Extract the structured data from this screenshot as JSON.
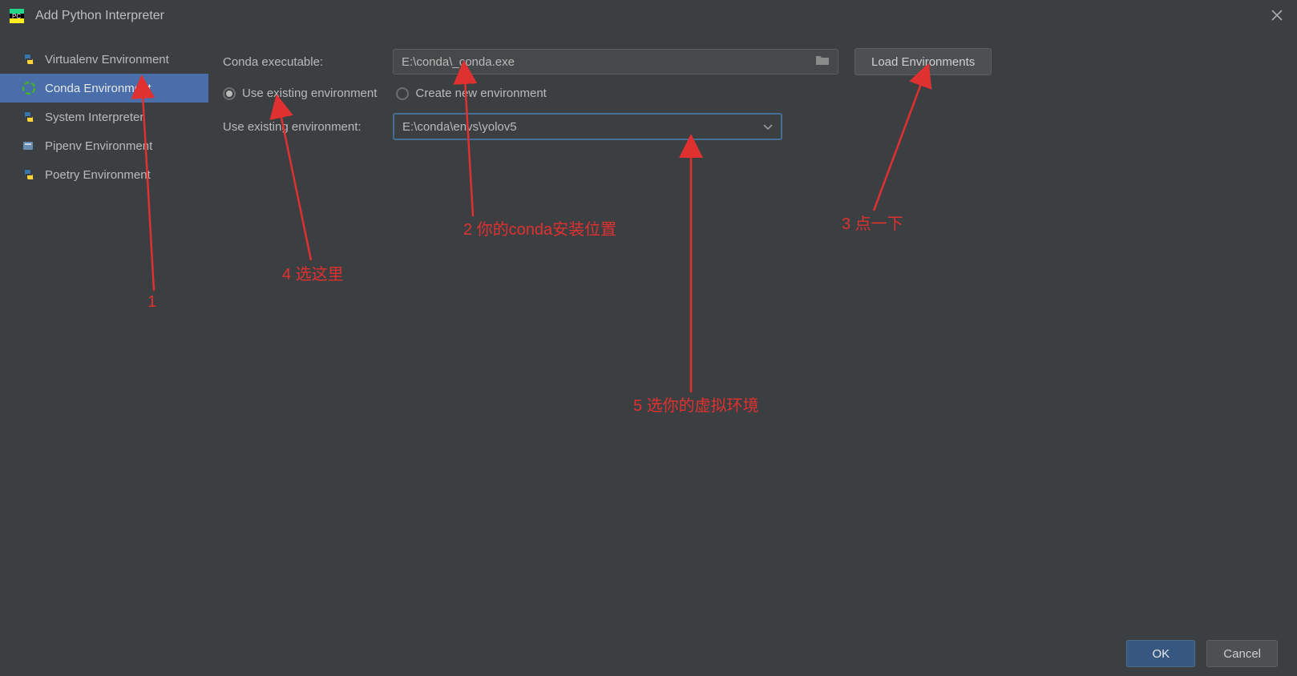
{
  "window": {
    "title": "Add Python Interpreter"
  },
  "sidebar": {
    "items": [
      {
        "label": "Virtualenv Environment",
        "icon": "python-icon"
      },
      {
        "label": "Conda Environment",
        "icon": "conda-icon",
        "selected": true
      },
      {
        "label": "System Interpreter",
        "icon": "python-icon"
      },
      {
        "label": "Pipenv Environment",
        "icon": "pipenv-icon"
      },
      {
        "label": "Poetry Environment",
        "icon": "python-icon"
      }
    ]
  },
  "form": {
    "conda_executable_label": "Conda executable:",
    "conda_executable_value": "E:\\conda\\_conda.exe",
    "load_environments_label": "Load Environments",
    "radio_use_existing": "Use existing environment",
    "radio_create_new": "Create new environment",
    "use_existing_label": "Use existing environment:",
    "existing_env_value": "E:\\conda\\envs\\yolov5"
  },
  "footer": {
    "ok": "OK",
    "cancel": "Cancel"
  },
  "annotations": {
    "a1": "1",
    "a2": "2 你的conda安装位置",
    "a3": "3 点一下",
    "a4": "4 选这里",
    "a5": "5 选你的虚拟环境"
  }
}
